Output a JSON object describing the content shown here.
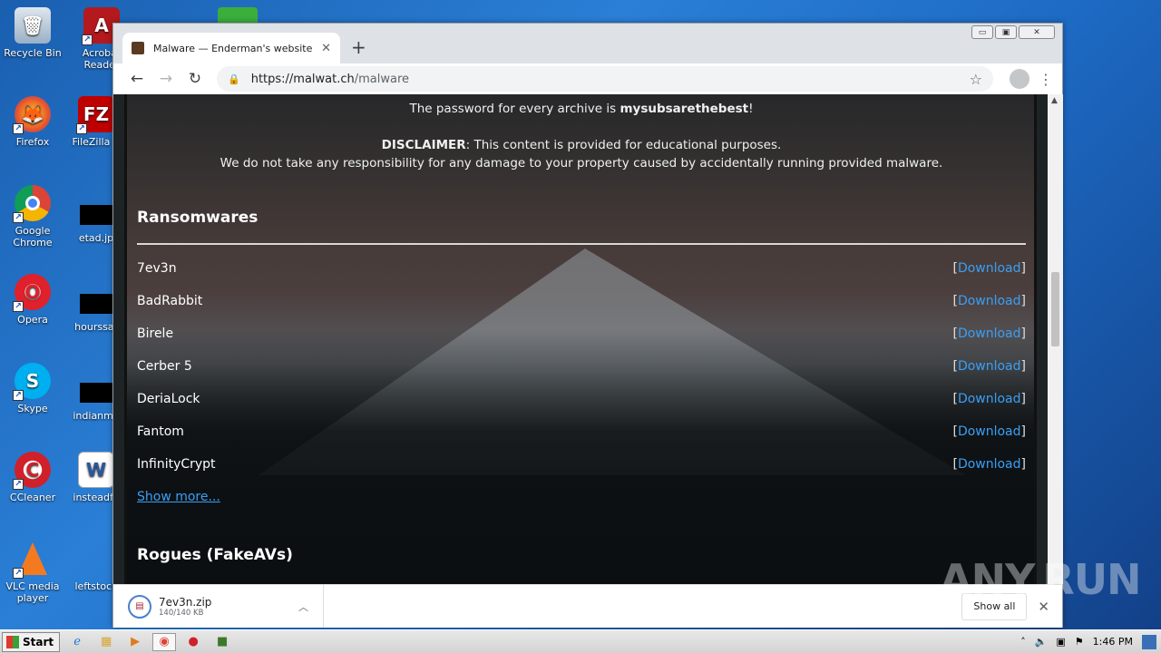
{
  "desktop": {
    "icons": [
      {
        "label": "Recycle Bin"
      },
      {
        "label": "Acrobat Reader"
      },
      {
        "label": "Firefox"
      },
      {
        "label": "FileZilla C"
      },
      {
        "label": "Google Chrome"
      },
      {
        "label": "etad.jp"
      },
      {
        "label": "Opera"
      },
      {
        "label": "hourssat"
      },
      {
        "label": "Skype"
      },
      {
        "label": "indianma"
      },
      {
        "label": "CCleaner"
      },
      {
        "label": "insteadfe"
      },
      {
        "label": "VLC media player"
      },
      {
        "label": "leftstock"
      }
    ]
  },
  "browser": {
    "tab_title": "Malware — Enderman's website",
    "url_host": "https://malwat.ch",
    "url_path": "/malware",
    "window_controls": {
      "minimize": "▭",
      "restore": "▣",
      "close": "✕"
    }
  },
  "page": {
    "password_line_prefix": "The password for every archive is ",
    "password": "mysubsarethebest",
    "password_line_suffix": "!",
    "disclaimer_label": "DISCLAIMER",
    "disclaimer_text": ": This content is provided for educational purposes.",
    "disclaimer_line2": "We do not take any responsibility for any damage to your property caused by accidentally running provided malware.",
    "section_ransomwares": "Ransomwares",
    "download_label": "Download",
    "items": [
      "7ev3n",
      "BadRabbit",
      "Birele",
      "Cerber 5",
      "DeriaLock",
      "Fantom",
      "InfinityCrypt"
    ],
    "show_more": "Show more...",
    "section_rogues": "Rogues (FakeAVs)"
  },
  "downloads": {
    "file_name": "7ev3n.zip",
    "file_size": "140/140 KB",
    "show_all": "Show all"
  },
  "taskbar": {
    "start_label": "Start",
    "clock": "1:46 PM"
  },
  "watermark": "ANY.RUN",
  "colors": {
    "link": "#3a9ff5",
    "accent": "#1a73e8"
  }
}
